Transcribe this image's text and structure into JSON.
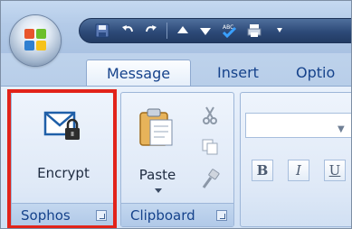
{
  "tabs": [
    {
      "label": "Message",
      "active": true
    },
    {
      "label": "Insert",
      "active": false
    },
    {
      "label": "Optio",
      "active": false
    }
  ],
  "groups": {
    "sophos": {
      "label": "Sophos",
      "encrypt_label": "Encrypt"
    },
    "clipboard": {
      "label": "Clipboard",
      "paste_label": "Paste"
    }
  },
  "format_buttons": {
    "bold": "B",
    "italic": "I",
    "underline": "U"
  },
  "icons": {
    "office_button": "office-logo-icon",
    "quick_access": [
      "save-icon",
      "undo-icon",
      "redo-icon",
      "up-arrow-icon",
      "down-arrow-icon",
      "spelling-icon",
      "print-icon"
    ]
  },
  "colors": {
    "highlight": "#e2231a",
    "tab_text": "#15428b"
  }
}
